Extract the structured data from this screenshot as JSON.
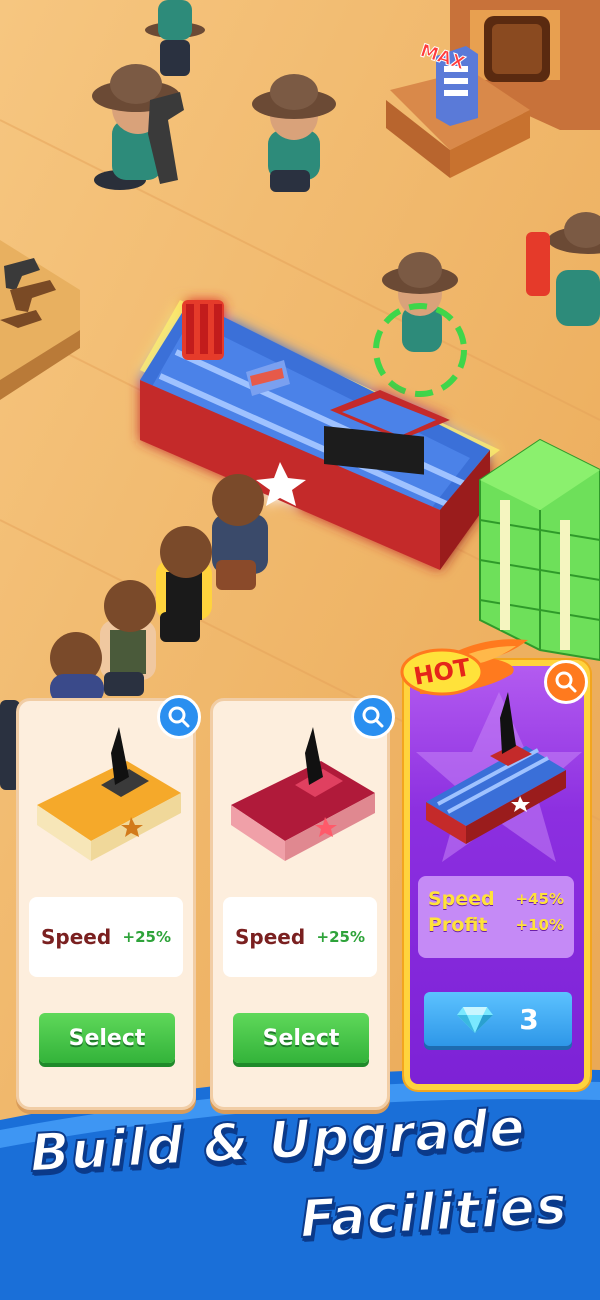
{
  "scene": {
    "max_label": "MAX"
  },
  "cards": [
    {
      "stat_name": "Speed",
      "stat_value": "+25%",
      "button_label": "Select",
      "color": "#f4a326"
    },
    {
      "stat_name": "Speed",
      "stat_value": "+25%",
      "button_label": "Select",
      "color": "#c02040"
    }
  ],
  "hot_card": {
    "badge": "HOT",
    "stats": [
      {
        "name": "Speed",
        "value": "+45%"
      },
      {
        "name": "Profit",
        "value": "+10%"
      }
    ],
    "price": "3",
    "currency_icon": "diamond-icon"
  },
  "banner": {
    "line1": "Build & Upgrade",
    "line2": "Facilities"
  },
  "colors": {
    "accent_green": "#33b33a",
    "accent_blue": "#2a8ff0",
    "hot_purple": "#8c2fe0",
    "hot_gold": "#ffd33d",
    "banner_blue": "#1a6fd8"
  }
}
